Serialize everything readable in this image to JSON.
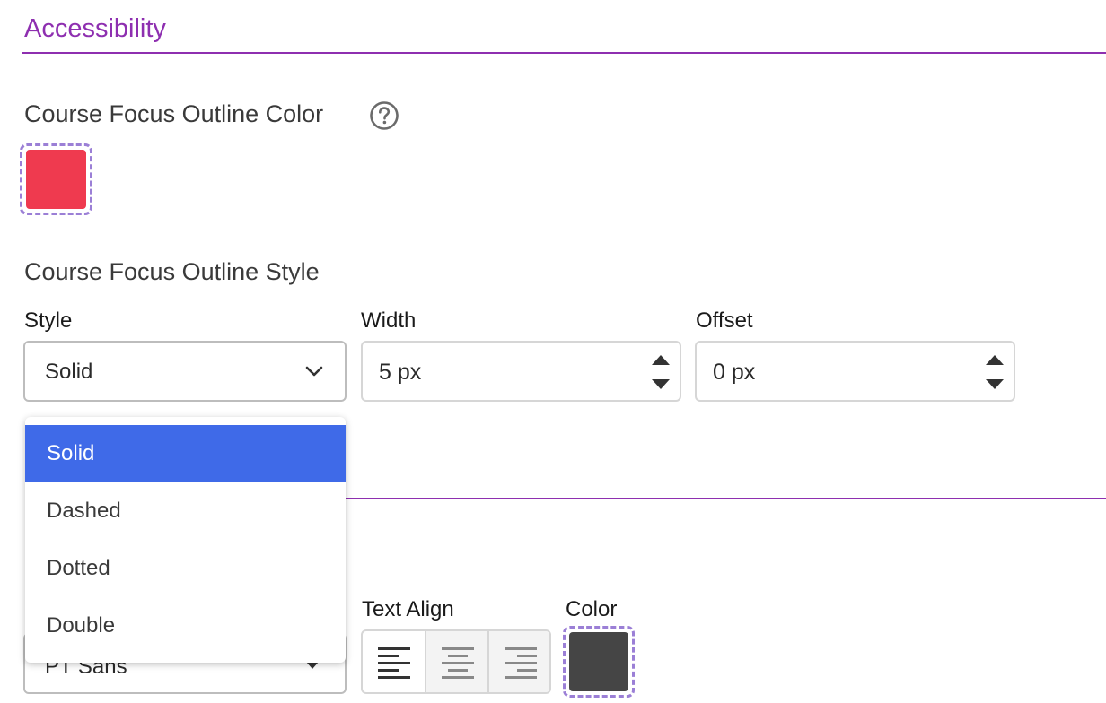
{
  "section": {
    "title": "Accessibility"
  },
  "focus_color": {
    "heading": "Course Focus Outline Color",
    "help_icon": "question-circle-icon",
    "swatch_color": "#ef3a4f"
  },
  "focus_style": {
    "heading": "Course Focus Outline Style",
    "style_label": "Style",
    "style_value": "Solid",
    "width_label": "Width",
    "width_value": "5 px",
    "offset_label": "Offset",
    "offset_value": "0 px",
    "options": [
      "Solid",
      "Dashed",
      "Dotted",
      "Double"
    ],
    "selected_option": "Solid"
  },
  "typography": {
    "font_value": "PT Sans",
    "text_align_label": "Text Align",
    "align_options": [
      "align-left-icon",
      "align-center-icon",
      "align-right-icon"
    ],
    "active_align": "align-left-icon",
    "color_label": "Color",
    "color_value": "#454545"
  },
  "colors": {
    "accent": "#8e2fb0",
    "selected_option_bg": "#3f6ae8",
    "swatch_dashed_border": "#9b7fd6"
  }
}
